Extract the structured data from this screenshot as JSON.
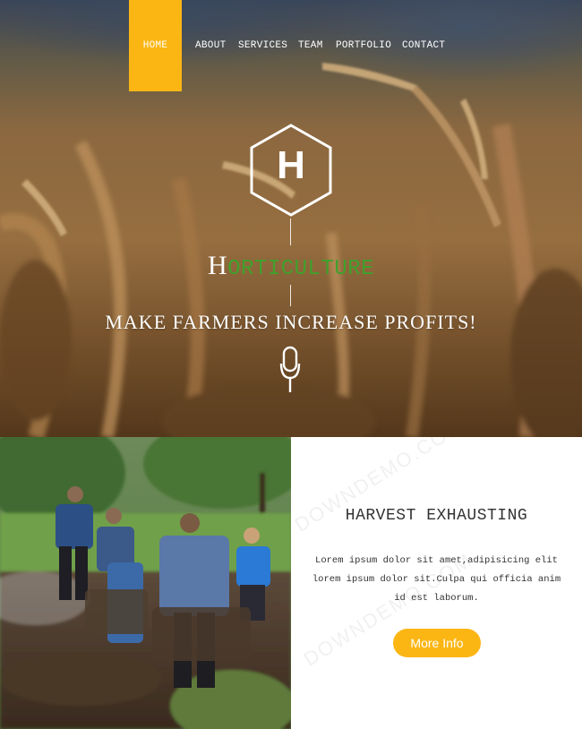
{
  "nav": {
    "items": [
      {
        "label": "HOME",
        "active": true
      },
      {
        "label": "ABOUT"
      },
      {
        "label": "SERVICES"
      },
      {
        "label": "TEAM"
      },
      {
        "label": "PORTFOLIO"
      },
      {
        "label": "CONTACT"
      }
    ]
  },
  "hero": {
    "logo_letter": "H",
    "brand_first": "H",
    "brand_rest": "ORTICULTURE",
    "tagline": "MAKE FARMERS INCREASE PROFITS!",
    "icon": "microphone-icon"
  },
  "feature": {
    "image": "farmers-plowing-field-photo",
    "title": "HARVEST EXHAUSTING",
    "body": "Lorem ipsum dolor sit amet,adipisicing elit lorem ipsum dolor sit.Culpa qui officia anim id est laborum.",
    "button_label": "More Info",
    "watermark": "DOWNDEMO.COM"
  },
  "colors": {
    "accent": "#fbb614",
    "brand_green": "#3fa12c",
    "text_dark": "#333333"
  }
}
